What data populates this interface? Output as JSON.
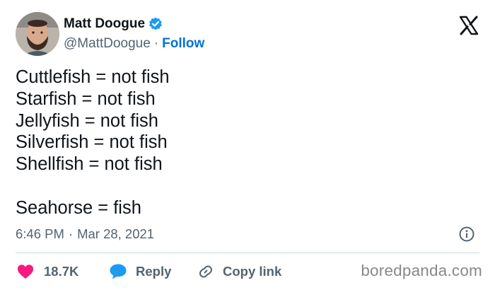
{
  "author": {
    "display_name": "Matt Doogue",
    "handle": "@MattDoogue",
    "separator": "·",
    "follow_label": "Follow",
    "verified": true
  },
  "tweet": {
    "lines": [
      "Cuttlefish = not fish",
      "Starfish = not fish",
      "Jellyfish = not fish",
      "Silverfish = not fish",
      "Shellfish = not fish",
      "",
      "Seahorse = fish"
    ]
  },
  "meta": {
    "time": "6:46 PM",
    "separator": "·",
    "date": "Mar 28, 2021"
  },
  "actions": {
    "likes": "18.7K",
    "reply_label": "Reply",
    "copy_link_label": "Copy link"
  },
  "watermark": "boredpanda.com",
  "colors": {
    "link_blue": "#0074d1",
    "verified_blue": "#1d9bf0",
    "heart_pink": "#f91880",
    "reply_blue": "#1d9bf0",
    "muted_gray": "#536471",
    "divider": "#cfd9de",
    "text": "#0f1419"
  },
  "icons": [
    "verified-badge-icon",
    "x-logo-icon",
    "info-icon",
    "heart-icon",
    "reply-bubble-icon",
    "link-icon"
  ]
}
